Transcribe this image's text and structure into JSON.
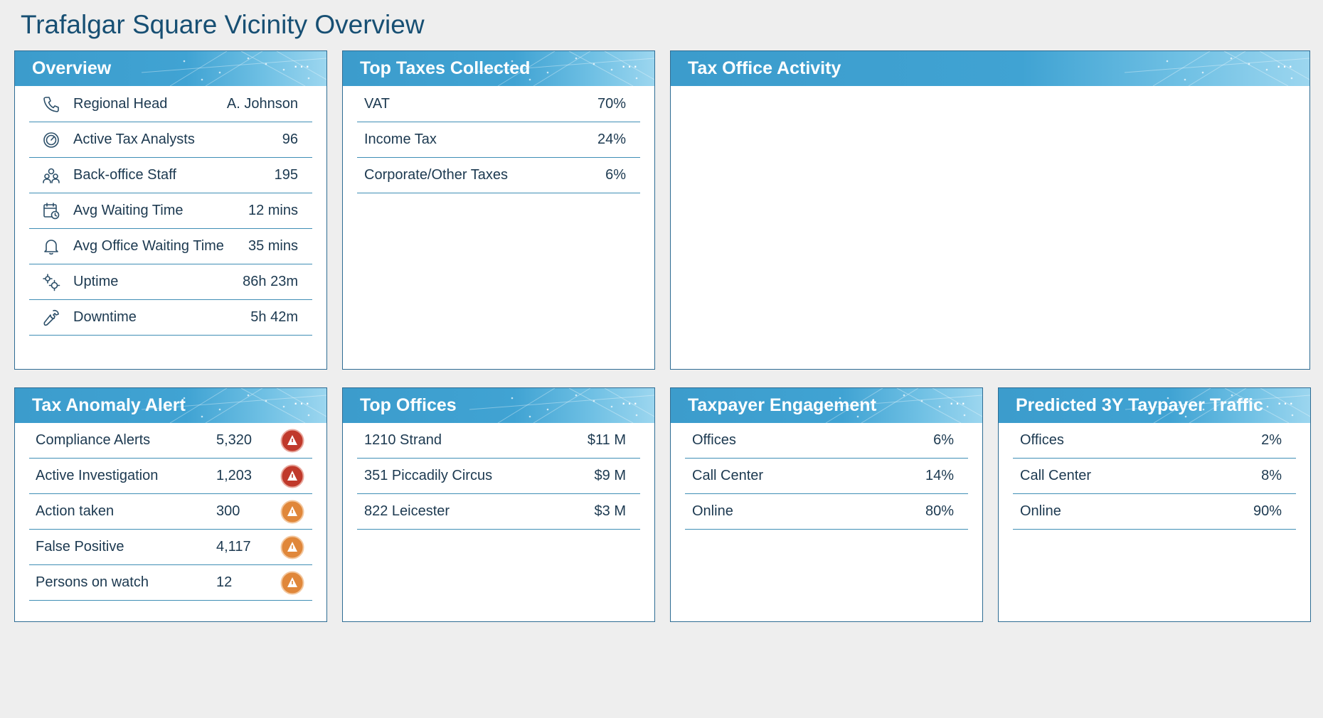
{
  "page_title": "Trafalgar Square Vicinity Overview",
  "colors": {
    "header": "#40a3d3",
    "text": "#17344d",
    "alert_high": "#c0392b",
    "alert_medium": "#e0873a"
  },
  "menu_glyph": "···",
  "overview": {
    "title": "Overview",
    "items": [
      {
        "icon": "phone-icon",
        "label": "Regional Head",
        "value": "A. Johnson"
      },
      {
        "icon": "gauge-icon",
        "label": "Active Tax Analysts",
        "value": "96"
      },
      {
        "icon": "people-icon",
        "label": "Back-office Staff",
        "value": "195"
      },
      {
        "icon": "calendar-clock-icon",
        "label": "Avg Waiting Time",
        "value": "12 mins"
      },
      {
        "icon": "bell-icon",
        "label": "Avg Office Waiting Time",
        "value": "35 mins"
      },
      {
        "icon": "gears-icon",
        "label": "Uptime",
        "value": "86h 23m"
      },
      {
        "icon": "wrench-icon",
        "label": "Downtime",
        "value": "5h 42m"
      }
    ]
  },
  "top_taxes": {
    "title": "Top Taxes Collected",
    "items": [
      {
        "label": "VAT",
        "value": "70%"
      },
      {
        "label": "Income Tax",
        "value": "24%"
      },
      {
        "label": "Corporate/Other Taxes",
        "value": "6%"
      }
    ]
  },
  "activity": {
    "title": "Tax Office Activity"
  },
  "anomaly": {
    "title": "Tax Anomaly Alert",
    "items": [
      {
        "label": "Compliance Alerts",
        "value": "5,320",
        "severity": "high"
      },
      {
        "label": "Active Investigation",
        "value": "1,203",
        "severity": "high"
      },
      {
        "label": "Action taken",
        "value": "300",
        "severity": "medium"
      },
      {
        "label": "False Positive",
        "value": "4,117",
        "severity": "medium"
      },
      {
        "label": "Persons on watch",
        "value": "12",
        "severity": "medium"
      }
    ]
  },
  "top_offices": {
    "title": "Top Offices",
    "items": [
      {
        "label": "1210 Strand",
        "value": "$11 M"
      },
      {
        "label": "351 Piccadily Circus",
        "value": "$9 M"
      },
      {
        "label": "822 Leicester",
        "value": "$3 M"
      }
    ]
  },
  "engagement": {
    "title": "Taxpayer Engagement",
    "items": [
      {
        "label": "Offices",
        "value": "6%"
      },
      {
        "label": "Call Center",
        "value": "14%"
      },
      {
        "label": "Online",
        "value": "80%"
      }
    ]
  },
  "predicted": {
    "title": "Predicted 3Y Taypayer Traffic",
    "items": [
      {
        "label": "Offices",
        "value": "2%"
      },
      {
        "label": "Call Center",
        "value": "8%"
      },
      {
        "label": "Online",
        "value": "90%"
      }
    ]
  }
}
